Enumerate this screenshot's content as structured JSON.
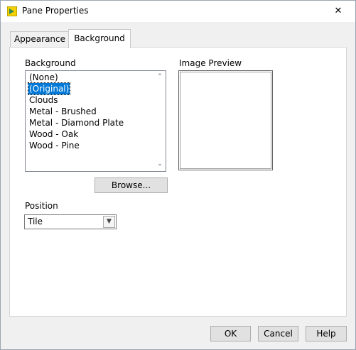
{
  "window": {
    "title": "Pane Properties",
    "close_glyph": "✕"
  },
  "tabs": [
    {
      "label": "Appearance",
      "active": false
    },
    {
      "label": "Background",
      "active": true
    }
  ],
  "background": {
    "label": "Background",
    "items": [
      "(None)",
      "(Original)",
      "Clouds",
      "Metal - Brushed",
      "Metal - Diamond Plate",
      "Wood - Oak",
      "Wood - Pine"
    ],
    "selected_index": 1
  },
  "preview": {
    "label": "Image Preview"
  },
  "browse_label": "Browse...",
  "position": {
    "label": "Position",
    "value": "Tile"
  },
  "footer": {
    "ok": "OK",
    "cancel": "Cancel",
    "help": "Help"
  },
  "colors": {
    "selection": "#0078d7",
    "icon_yellow": "#f5d000",
    "icon_green": "#2e8b57"
  }
}
